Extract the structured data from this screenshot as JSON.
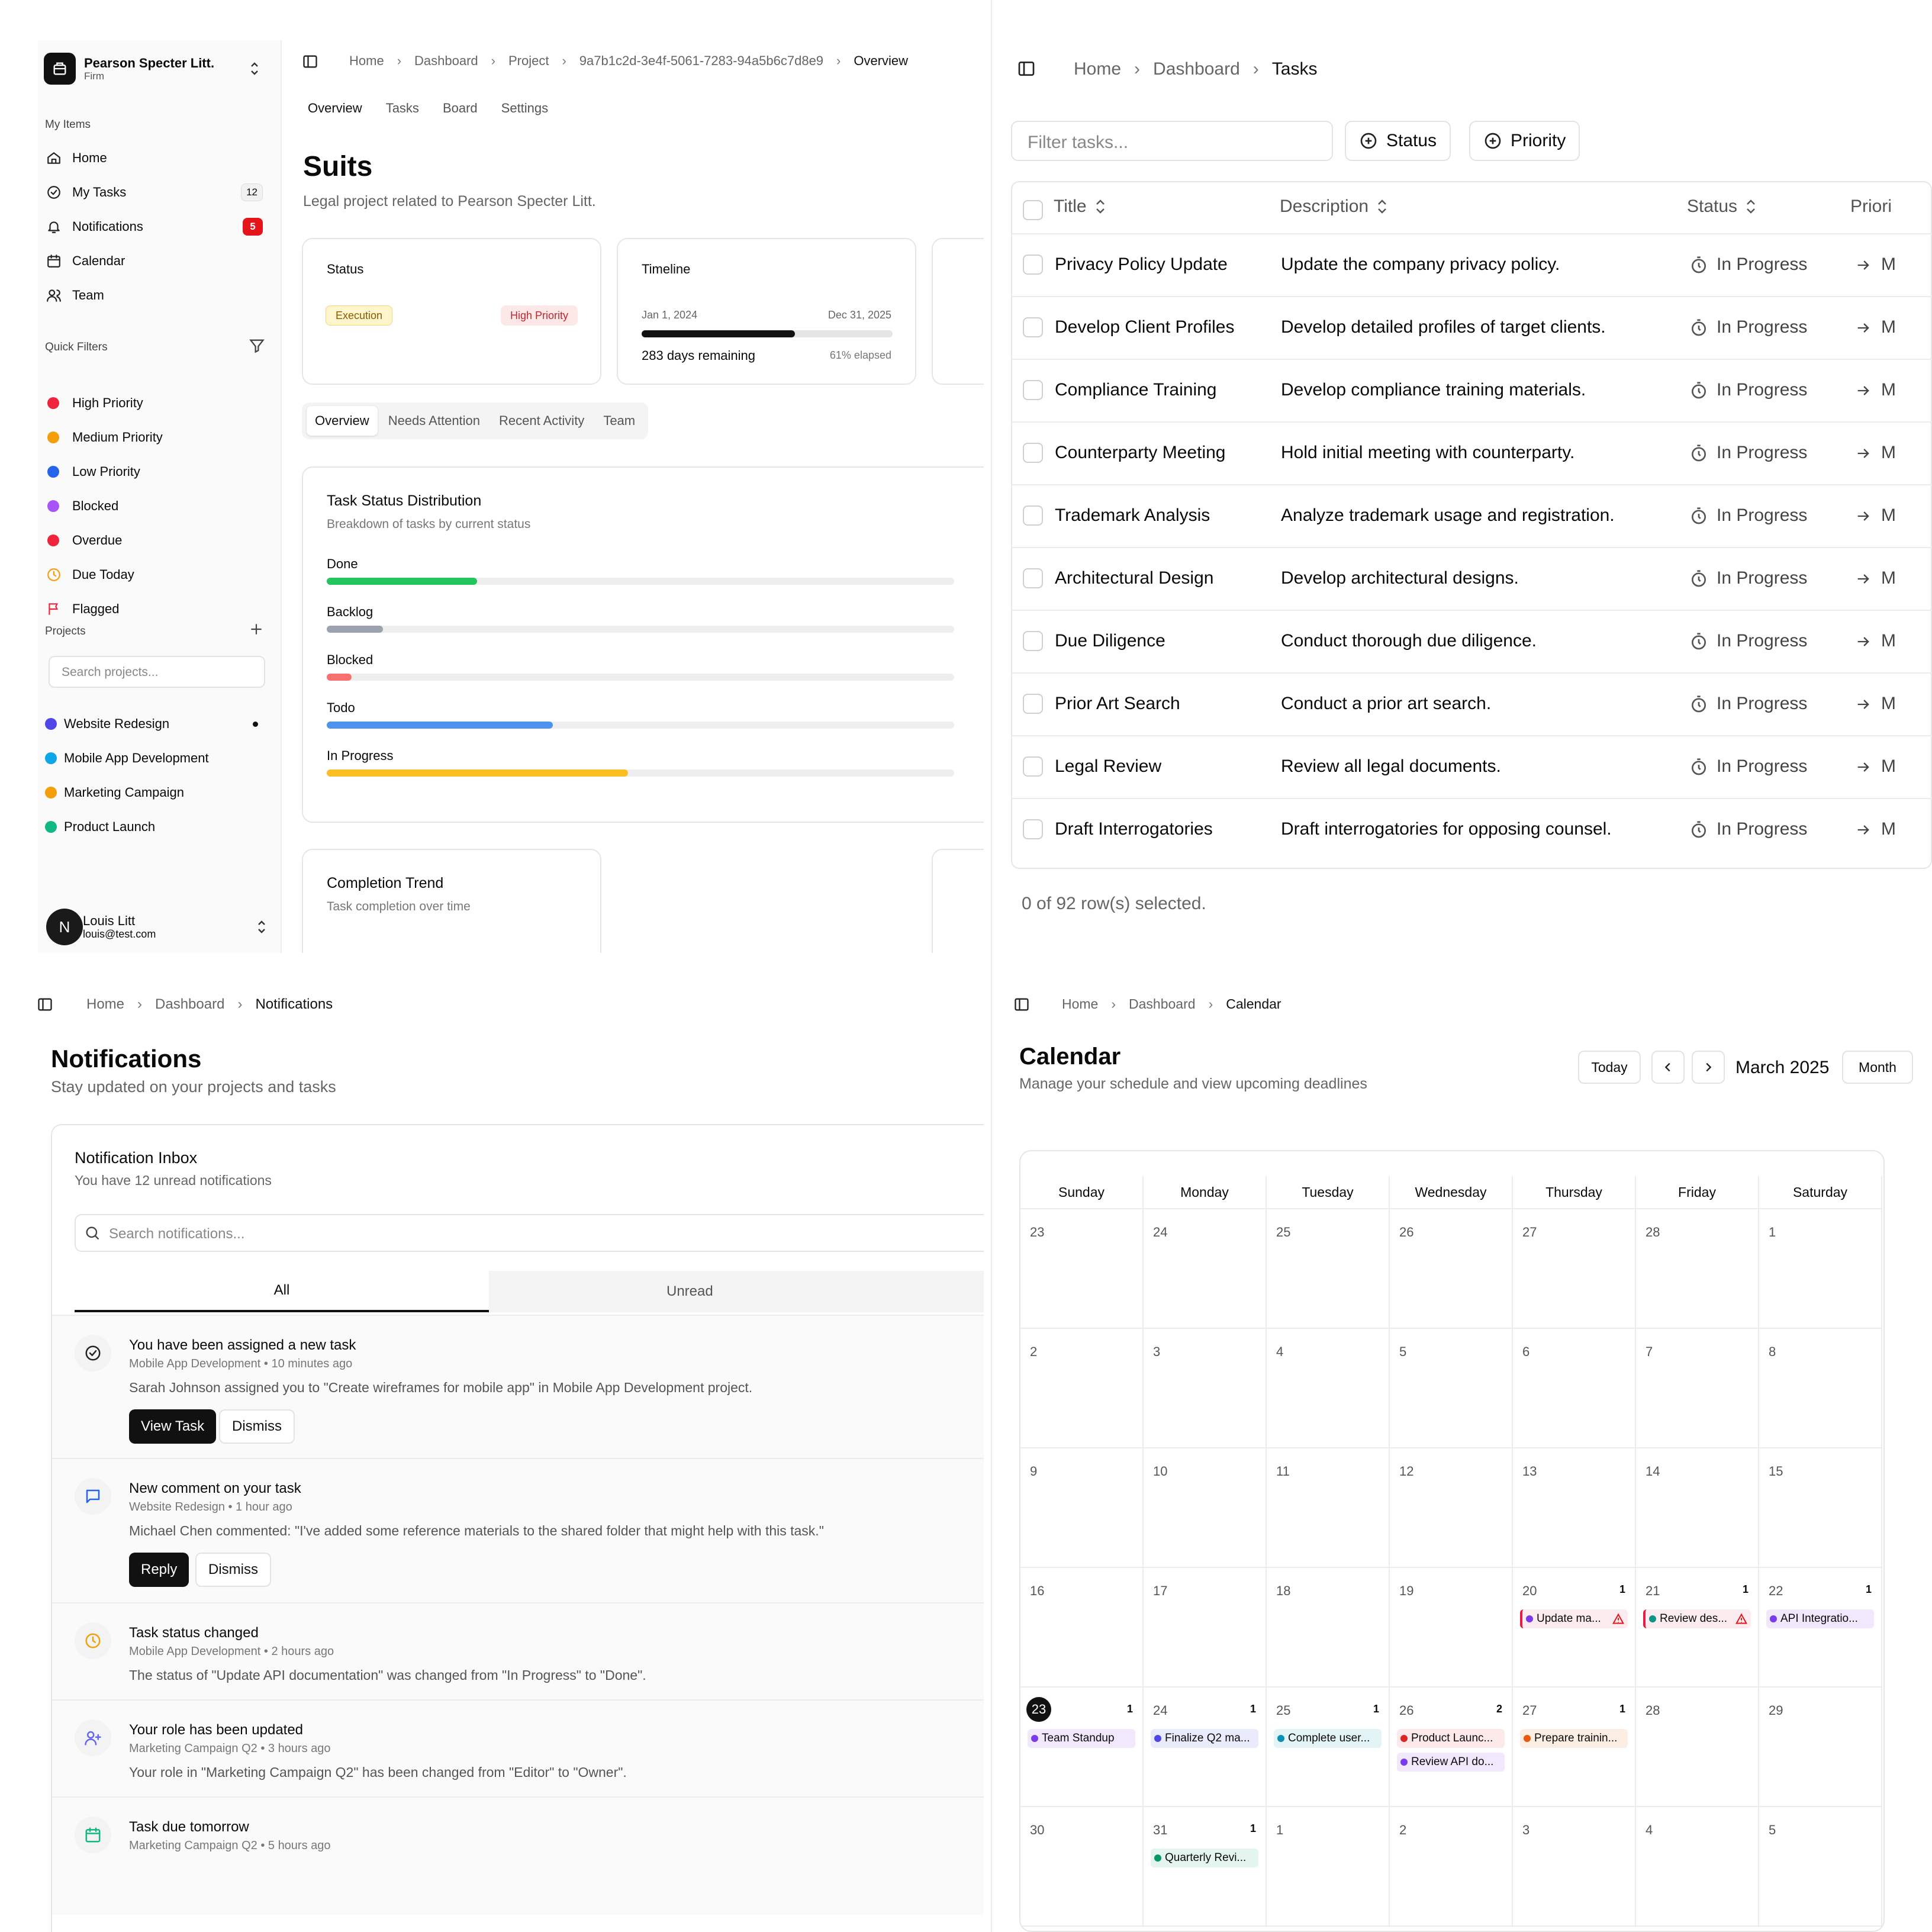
{
  "project_page": {
    "firm": {
      "name": "Pearson Specter Litt.",
      "type": "Firm"
    },
    "sections": {
      "my_items": "My Items",
      "quick_filters": "Quick Filters",
      "projects": "Projects"
    },
    "nav": [
      {
        "label": "Home",
        "icon": "home-icon"
      },
      {
        "label": "My Tasks",
        "icon": "check-circle-icon",
        "badge": "12"
      },
      {
        "label": "Notifications",
        "icon": "bell-icon",
        "badge": "5"
      },
      {
        "label": "Calendar",
        "icon": "calendar-icon"
      },
      {
        "label": "Team",
        "icon": "users-icon"
      }
    ],
    "filters": [
      {
        "label": "High Priority",
        "color": "#ef233c"
      },
      {
        "label": "Medium Priority",
        "color": "#f59e0b"
      },
      {
        "label": "Low Priority",
        "color": "#2563eb"
      },
      {
        "label": "Blocked",
        "color": "#a855f7"
      },
      {
        "label": "Overdue",
        "color": "#ef233c"
      },
      {
        "label": "Due Today",
        "color": "#f59e0b"
      },
      {
        "label": "Flagged",
        "color": "#ef233c"
      }
    ],
    "search_placeholder": "Search projects...",
    "projects": [
      {
        "label": "Website Redesign",
        "color": "#4f46e5"
      },
      {
        "label": "Mobile App Development",
        "color": "#0ea5e9"
      },
      {
        "label": "Marketing Campaign",
        "color": "#f59e0b"
      },
      {
        "label": "Product Launch",
        "color": "#10b981"
      }
    ],
    "user": {
      "name": "Louis Litt",
      "email": "louis@test.com",
      "initial": "N"
    },
    "breadcrumb": [
      "Home",
      "Dashboard",
      "Project",
      "9a7b1c2d-3e4f-5061-7283-94a5b6c7d8e9",
      "Overview"
    ],
    "tabs": [
      "Overview",
      "Tasks",
      "Board",
      "Settings"
    ],
    "title": "Suits",
    "subtitle": "Legal project related to Pearson Specter Litt.",
    "status_card": {
      "title": "Status",
      "phase": "Execution",
      "priority": "High Priority"
    },
    "timeline_card": {
      "title": "Timeline",
      "start": "Jan 1, 2024",
      "end": "Dec 31, 2025",
      "remaining": "283 days remaining",
      "elapsed": "61% elapsed",
      "elapsed_fraction": 0.61
    },
    "subtabs": [
      "Overview",
      "Needs Attention",
      "Recent Activity",
      "Team"
    ],
    "distribution": {
      "title": "Task Status Distribution",
      "subtitle": "Breakdown of tasks by current status",
      "rows": [
        {
          "label": "Done",
          "fraction": 0.24,
          "color": "#22c55e"
        },
        {
          "label": "Backlog",
          "fraction": 0.09,
          "color": "#9ca3af"
        },
        {
          "label": "Blocked",
          "fraction": 0.04,
          "color": "#f87171"
        },
        {
          "label": "Todo",
          "fraction": 0.36,
          "color": "#4d94f0"
        },
        {
          "label": "In Progress",
          "fraction": 0.48,
          "color": "#fbbf24"
        }
      ]
    },
    "trend": {
      "title": "Completion Trend",
      "subtitle": "Task completion over time"
    }
  },
  "tasks_page": {
    "breadcrumb": [
      "Home",
      "Dashboard",
      "Tasks"
    ],
    "filter_placeholder": "Filter tasks...",
    "buttons": [
      "Status",
      "Priority"
    ],
    "columns": [
      "Title",
      "Description",
      "Status",
      "Priori"
    ],
    "rows": [
      {
        "title": "Privacy Policy Update",
        "description": "Update the company privacy policy.",
        "status": "In Progress"
      },
      {
        "title": "Develop Client Profiles",
        "description": "Develop detailed profiles of target clients.",
        "status": "In Progress"
      },
      {
        "title": "Compliance Training",
        "description": "Develop compliance training materials.",
        "status": "In Progress"
      },
      {
        "title": "Counterparty Meeting",
        "description": "Hold initial meeting with counterparty.",
        "status": "In Progress"
      },
      {
        "title": "Trademark Analysis",
        "description": "Analyze trademark usage and registration.",
        "status": "In Progress"
      },
      {
        "title": "Architectural Design",
        "description": "Develop architectural designs.",
        "status": "In Progress"
      },
      {
        "title": "Due Diligence",
        "description": "Conduct thorough due diligence.",
        "status": "In Progress"
      },
      {
        "title": "Prior Art Search",
        "description": "Conduct a prior art search.",
        "status": "In Progress"
      },
      {
        "title": "Legal Review",
        "description": "Review all legal documents.",
        "status": "In Progress"
      },
      {
        "title": "Draft Interrogatories",
        "description": "Draft interrogatories for opposing counsel.",
        "status": "In Progress"
      }
    ],
    "priority_glyph": "M",
    "footer": "0 of 92 row(s) selected."
  },
  "notifications_page": {
    "breadcrumb": [
      "Home",
      "Dashboard",
      "Notifications"
    ],
    "title": "Notifications",
    "subtitle": "Stay updated on your projects and tasks",
    "inbox_title": "Notification Inbox",
    "inbox_sub": "You have 12 unread notifications",
    "search_placeholder": "Search notifications...",
    "tabs": [
      "All",
      "Unread"
    ],
    "items": [
      {
        "title": "You have been assigned a new task",
        "meta": "Mobile App Development • 10 minutes ago",
        "body": "Sarah Johnson assigned you to \"Create wireframes for mobile app\" in Mobile App Development project.",
        "primary": "View Task",
        "secondary": "Dismiss",
        "icon": "check-circle-icon"
      },
      {
        "title": "New comment on your task",
        "meta": "Website Redesign • 1 hour ago",
        "body": "Michael Chen commented: \"I've added some reference materials to the shared folder that might help with this task.\"",
        "primary": "Reply",
        "secondary": "Dismiss",
        "icon": "message-icon"
      },
      {
        "title": "Task status changed",
        "meta": "Mobile App Development • 2 hours ago",
        "body": "The status of \"Update API documentation\" was changed from \"In Progress\" to \"Done\".",
        "icon": "clock-icon"
      },
      {
        "title": "Your role has been updated",
        "meta": "Marketing Campaign Q2 • 3 hours ago",
        "body": "Your role in \"Marketing Campaign Q2\" has been changed from \"Editor\" to \"Owner\".",
        "icon": "user-plus-icon"
      },
      {
        "title": "Task due tomorrow",
        "meta": "Marketing Campaign Q2 • 5 hours ago",
        "body": "",
        "icon": "calendar-icon"
      }
    ]
  },
  "calendar_page": {
    "breadcrumb": [
      "Home",
      "Dashboard",
      "Calendar"
    ],
    "title": "Calendar",
    "subtitle": "Manage your schedule and view upcoming deadlines",
    "today_label": "Today",
    "month_label": "March 2025",
    "view_label": "Month",
    "weekdays": [
      "Sunday",
      "Monday",
      "Tuesday",
      "Wednesday",
      "Thursday",
      "Friday",
      "Saturday"
    ],
    "weeks": [
      [
        {
          "d": "23"
        },
        {
          "d": "24"
        },
        {
          "d": "25"
        },
        {
          "d": "26"
        },
        {
          "d": "27"
        },
        {
          "d": "28"
        },
        {
          "d": "1"
        }
      ],
      [
        {
          "d": "2"
        },
        {
          "d": "3"
        },
        {
          "d": "4"
        },
        {
          "d": "5"
        },
        {
          "d": "6"
        },
        {
          "d": "7"
        },
        {
          "d": "8"
        }
      ],
      [
        {
          "d": "9"
        },
        {
          "d": "10"
        },
        {
          "d": "11"
        },
        {
          "d": "12"
        },
        {
          "d": "13"
        },
        {
          "d": "14"
        },
        {
          "d": "15"
        }
      ],
      [
        {
          "d": "16"
        },
        {
          "d": "17"
        },
        {
          "d": "18"
        },
        {
          "d": "19"
        },
        {
          "d": "20",
          "n": "1",
          "ev": [
            {
              "t": "Update ma...",
              "bg": "#fdecef",
              "dot": "#7c3aed",
              "bar": "#e11d48",
              "warn": true
            }
          ]
        },
        {
          "d": "21",
          "n": "1",
          "ev": [
            {
              "t": "Review des...",
              "bg": "#fdecef",
              "dot": "#0d9488",
              "bar": "#e11d48",
              "warn": true
            }
          ]
        },
        {
          "d": "22",
          "n": "1",
          "ev": [
            {
              "t": "API Integratio...",
              "bg": "#f1e8fd",
              "dot": "#7c3aed"
            }
          ]
        }
      ],
      [
        {
          "d": "23",
          "n": "1",
          "today": true,
          "ev": [
            {
              "t": "Team Standup",
              "bg": "#f1e8fd",
              "dot": "#7c3aed"
            }
          ]
        },
        {
          "d": "24",
          "n": "1",
          "ev": [
            {
              "t": "Finalize Q2 ma...",
              "bg": "#eaeafd",
              "dot": "#4f46e5"
            }
          ]
        },
        {
          "d": "25",
          "n": "1",
          "ev": [
            {
              "t": "Complete user...",
              "bg": "#e3f4f7",
              "dot": "#0891b2"
            }
          ]
        },
        {
          "d": "26",
          "n": "2",
          "ev": [
            {
              "t": "Product Launc...",
              "bg": "#fde8ea",
              "dot": "#dc2626"
            },
            {
              "t": "Review API do...",
              "bg": "#f1e8fd",
              "dot": "#7c3aed"
            }
          ]
        },
        {
          "d": "27",
          "n": "1",
          "ev": [
            {
              "t": "Prepare trainin...",
              "bg": "#fdeee3",
              "dot": "#ea580c"
            }
          ]
        },
        {
          "d": "28"
        },
        {
          "d": "29"
        }
      ],
      [
        {
          "d": "30"
        },
        {
          "d": "31",
          "n": "1",
          "ev": [
            {
              "t": "Quarterly Revi...",
              "bg": "#e3f5ee",
              "dot": "#059669"
            }
          ]
        },
        {
          "d": "1"
        },
        {
          "d": "2"
        },
        {
          "d": "3"
        },
        {
          "d": "4"
        },
        {
          "d": "5"
        }
      ]
    ]
  }
}
